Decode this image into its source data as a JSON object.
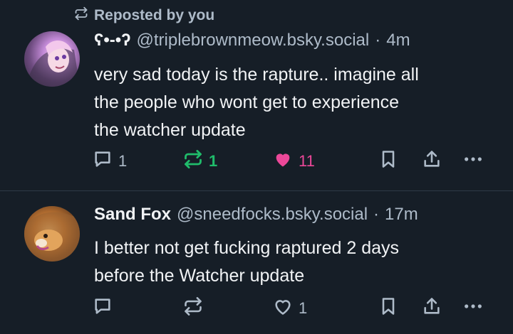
{
  "repost_header": {
    "label": "Reposted by you"
  },
  "posts": [
    {
      "display_name": "ʕ•-•ʔ",
      "handle": "@triplebrownmeow.bsky.social",
      "separator": "·",
      "time": "4m",
      "lines": [
        "very sad today is the rapture.. imagine all",
        "the people who wont get to experience",
        "the watcher update"
      ],
      "reply_count": "1",
      "repost_count": "1",
      "like_count": "11",
      "reposted": true,
      "liked": true
    },
    {
      "display_name": "Sand Fox",
      "handle": "@sneedfocks.bsky.social",
      "separator": "·",
      "time": "17m",
      "lines": [
        "I better not get fucking raptured 2 days",
        "before the Watcher update"
      ],
      "reply_count": "",
      "repost_count": "",
      "like_count": "1",
      "reposted": false,
      "liked": false
    }
  ],
  "icons": {
    "repost": "repost-icon",
    "reply": "reply-icon",
    "like": "heart-icon",
    "bookmark": "bookmark-icon",
    "share": "share-icon",
    "more": "more-icon"
  },
  "colors": {
    "background": "#161e27",
    "text": "#f1f3f5",
    "muted": "#aebbc9",
    "repost_active": "#20bc6b",
    "like_active": "#ec4899",
    "divider": "#2e3a47"
  }
}
